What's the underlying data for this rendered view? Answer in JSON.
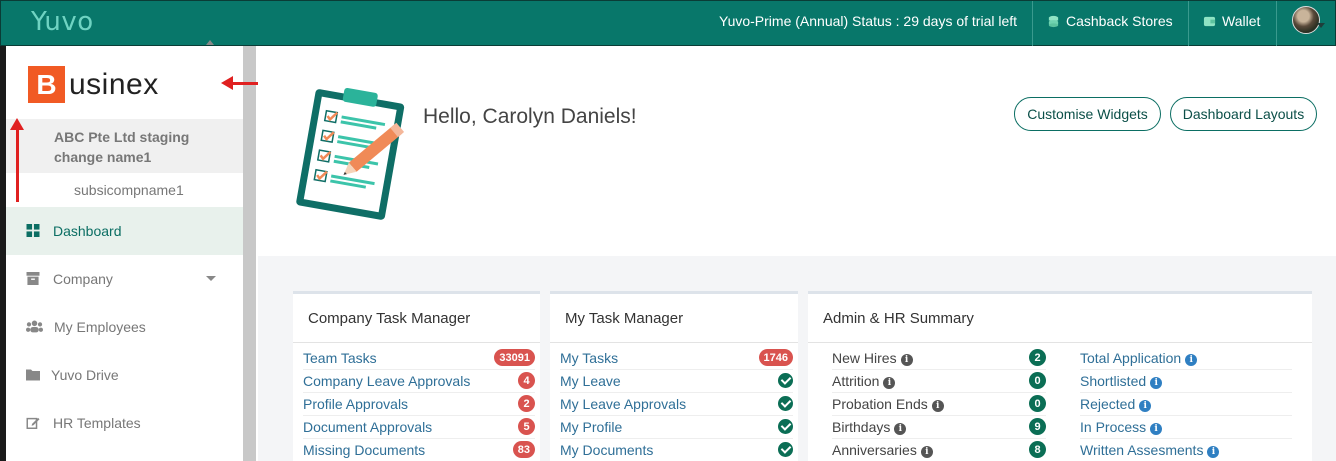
{
  "topbar": {
    "logo": "Yuvo",
    "trial_status": "Yuvo-Prime (Annual) Status : 29 days of trial left",
    "cashback_label": "Cashback Stores",
    "wallet_label": "Wallet"
  },
  "sidebar": {
    "brand_initial": "B",
    "brand_rest": "usinex",
    "company_name": "ABC Pte Ltd staging change name1",
    "subsidiary": "subsicompname1",
    "items": [
      {
        "label": "Dashboard",
        "icon": "grid-icon",
        "active": true
      },
      {
        "label": "Company",
        "icon": "archive-icon",
        "has_caret": true
      },
      {
        "label": "My Employees",
        "icon": "users-icon"
      },
      {
        "label": "Yuvo Drive",
        "icon": "folder-icon"
      },
      {
        "label": "HR Templates",
        "icon": "edit-icon"
      }
    ]
  },
  "main": {
    "greeting": "Hello, Carolyn Daniels!",
    "customise_label": "Customise Widgets",
    "layouts_label": "Dashboard Layouts"
  },
  "widgets": {
    "company_tasks": {
      "title": "Company Task Manager",
      "rows": [
        {
          "label": "Team Tasks",
          "count": "33091"
        },
        {
          "label": "Company Leave Approvals",
          "count": "4"
        },
        {
          "label": "Profile Approvals",
          "count": "2"
        },
        {
          "label": "Document Approvals",
          "count": "5"
        },
        {
          "label": "Missing Documents",
          "count": "83"
        }
      ]
    },
    "my_tasks": {
      "title": "My Task Manager",
      "rows": [
        {
          "label": "My Tasks",
          "count": "1746"
        },
        {
          "label": "My Leave",
          "status": "done"
        },
        {
          "label": "My Leave Approvals",
          "status": "done"
        },
        {
          "label": "My Profile",
          "status": "done"
        },
        {
          "label": "My Documents",
          "status": "done"
        }
      ]
    },
    "admin_hr": {
      "title": "Admin & HR Summary",
      "left_rows": [
        {
          "label": "New Hires",
          "count": "2"
        },
        {
          "label": "Attrition",
          "count": "0"
        },
        {
          "label": "Probation Ends",
          "count": "0"
        },
        {
          "label": "Birthdays",
          "count": "9"
        },
        {
          "label": "Anniversaries",
          "count": "8"
        }
      ],
      "right_rows": [
        {
          "label": "Total Application"
        },
        {
          "label": "Shortlisted"
        },
        {
          "label": "Rejected"
        },
        {
          "label": "In Process"
        },
        {
          "label": "Written Assesments"
        }
      ]
    }
  },
  "colors": {
    "topbar": "#08776a",
    "accent": "#0b6e63",
    "badge_red": "#d9534f",
    "badge_green": "#0b6e55",
    "brand_orange": "#f15a24",
    "link_blue": "#2f6f97"
  }
}
